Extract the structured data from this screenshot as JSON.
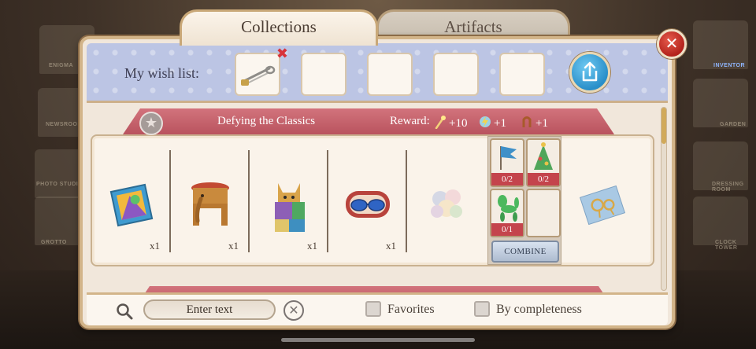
{
  "tabs": {
    "collections": "Collections",
    "artifacts": "Artifacts"
  },
  "wish_list": {
    "label": "My wish list:",
    "slots": [
      "safety pin",
      "",
      "",
      "",
      ""
    ],
    "remove_symbol": "✖"
  },
  "collection": {
    "title": "Defying the Classics",
    "reward_label": "Reward:",
    "rewards": [
      "+10",
      "+1",
      "+1"
    ],
    "items": [
      {
        "name": "colorful picture",
        "qty": "x1"
      },
      {
        "name": "elephant stool",
        "qty": "x1"
      },
      {
        "name": "cubist cat",
        "qty": "x1"
      },
      {
        "name": "glasses case",
        "qty": "x1"
      }
    ],
    "result_item": "flower bouquet",
    "combine_parts": [
      {
        "name": "flag",
        "count": "0/2"
      },
      {
        "name": "party hat",
        "count": "0/2"
      },
      {
        "name": "balloon dog",
        "count": "0/1"
      },
      {
        "name": "empty",
        "count": ""
      }
    ],
    "combine_label": "COMBINE",
    "artifact": "jewelry pattern"
  },
  "search": {
    "placeholder": "Enter text"
  },
  "filters": {
    "favorites": "Favorites",
    "by_completeness": "By completeness"
  },
  "background": {
    "labels": [
      "ENIGMA",
      "NEWSROOM",
      "PHOTO STUDIO",
      "GROTTO",
      "INVENTOR",
      "GARDEN",
      "DRESSING ROOM",
      "CLOCK TOWER"
    ]
  },
  "colors": {
    "header_pink": "#c25e68",
    "wish_bg": "#bcc5e4",
    "close_red": "#c8332a",
    "share_blue": "#3aa4db"
  }
}
